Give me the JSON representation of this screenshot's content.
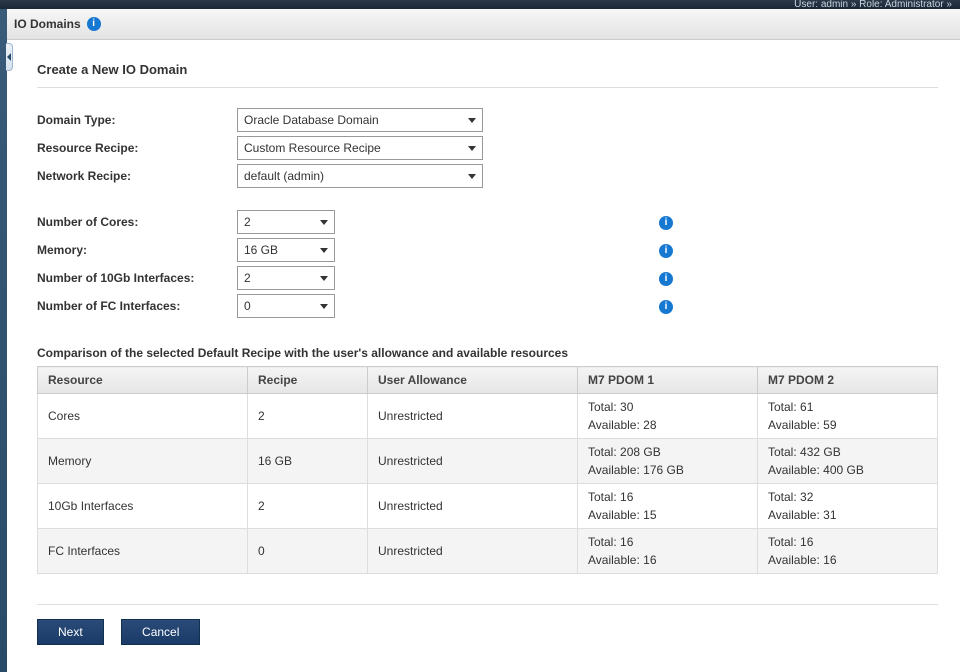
{
  "topbar": "User: admin » Role: Administrator »",
  "header": {
    "title": "IO Domains"
  },
  "page": {
    "title": "Create a New IO Domain"
  },
  "form": {
    "domain_type": {
      "label": "Domain Type:",
      "value": "Oracle Database Domain"
    },
    "resource_recipe": {
      "label": "Resource Recipe:",
      "value": "Custom Resource Recipe"
    },
    "network_recipe": {
      "label": "Network Recipe:",
      "value": "default (admin)"
    },
    "cores": {
      "label": "Number of Cores:",
      "value": "2"
    },
    "memory": {
      "label": "Memory:",
      "value": "16 GB"
    },
    "ten_gb": {
      "label": "Number of 10Gb Interfaces:",
      "value": "2"
    },
    "fc": {
      "label": "Number of FC Interfaces:",
      "value": "0"
    }
  },
  "table": {
    "title": "Comparison of the selected Default Recipe with the user's allowance and available resources",
    "headers": {
      "resource": "Resource",
      "recipe": "Recipe",
      "user": "User Allowance",
      "p1": "M7 PDOM 1",
      "p2": "M7 PDOM 2"
    },
    "rows": [
      {
        "resource": "Cores",
        "recipe": "2",
        "user": "Unrestricted",
        "p1t": "Total: 30",
        "p1a": "Available: 28",
        "p2t": "Total: 61",
        "p2a": "Available: 59"
      },
      {
        "resource": "Memory",
        "recipe": "16 GB",
        "user": "Unrestricted",
        "p1t": "Total: 208 GB",
        "p1a": "Available: 176 GB",
        "p2t": "Total: 432 GB",
        "p2a": "Available: 400 GB"
      },
      {
        "resource": "10Gb Interfaces",
        "recipe": "2",
        "user": "Unrestricted",
        "p1t": "Total: 16",
        "p1a": "Available: 15",
        "p2t": "Total: 32",
        "p2a": "Available: 31"
      },
      {
        "resource": "FC Interfaces",
        "recipe": "0",
        "user": "Unrestricted",
        "p1t": "Total: 16",
        "p1a": "Available: 16",
        "p2t": "Total: 16",
        "p2a": "Available: 16"
      }
    ]
  },
  "buttons": {
    "next": "Next",
    "cancel": "Cancel"
  }
}
